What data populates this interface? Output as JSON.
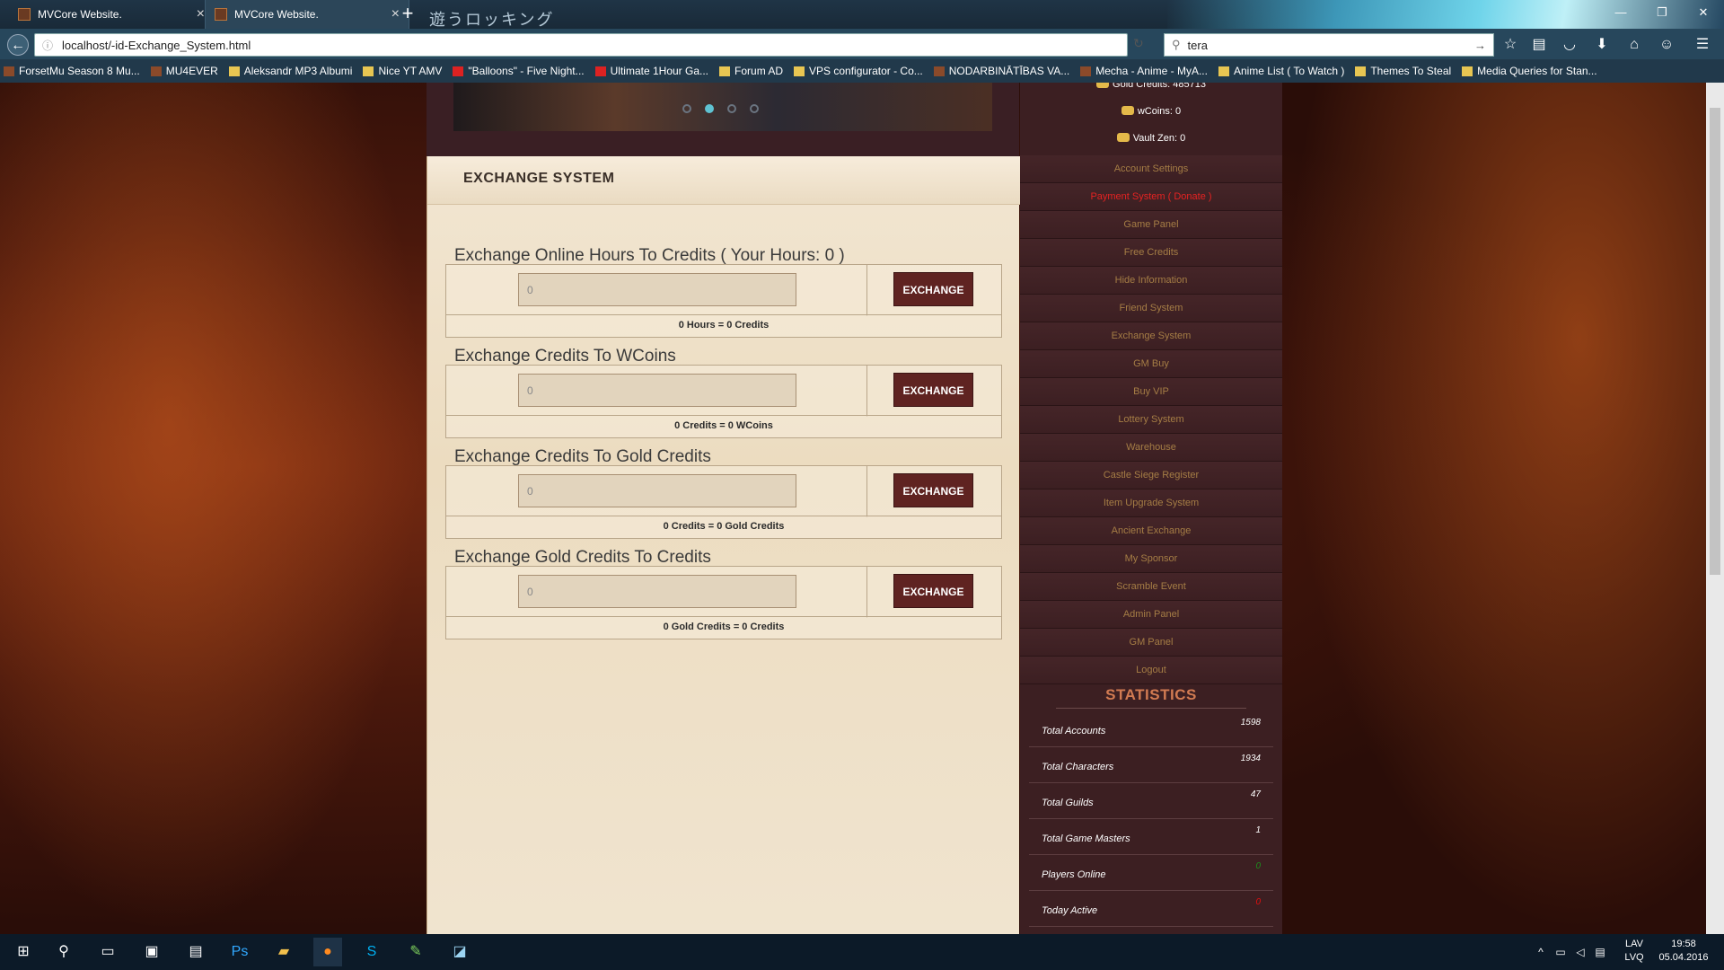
{
  "browser": {
    "tabs": [
      {
        "title": "MVCore Website.",
        "active": false
      },
      {
        "title": "MVCore Website.",
        "active": true
      }
    ],
    "banner_text": "遊うロッキング",
    "url": "localhost/-id-Exchange_System.html",
    "search_query": "tera",
    "bookmarks": [
      "ForsetMu Season 8 Mu...",
      "MU4EVER",
      "Aleksandr MP3 Albumi",
      "Nice YT AMV",
      "\"Balloons\" - Five Night...",
      "Ultimate 1Hour Ga...",
      "Forum AD",
      "VPS configurator - Co...",
      "NODARBINĀTĪBAS VA...",
      "Mecha - Anime - MyA...",
      "Anime List ( To Watch )",
      "Themes To Steal",
      "Media Queries for Stan..."
    ]
  },
  "page": {
    "title": "EXCHANGE SYSTEM",
    "exchange_button_label": "EXCHANGE",
    "exchanges": [
      {
        "heading": "Exchange Online Hours To Credits ( Your Hours: 0 )",
        "value": "0",
        "result": "0 Hours = 0 Credits"
      },
      {
        "heading": "Exchange Credits To WCoins",
        "value": "0",
        "result": "0 Credits = 0 WCoins"
      },
      {
        "heading": "Exchange Credits To Gold Credits",
        "value": "0",
        "result": "0 Credits = 0 Gold Credits"
      },
      {
        "heading": "Exchange Gold Credits To Credits",
        "value": "0",
        "result": "0 Gold Credits = 0 Credits"
      }
    ]
  },
  "sidebar": {
    "gold_credits": "Gold Credits: 485713",
    "wcoins": "wCoins: 0",
    "vault_zen": "Vault Zen: 0",
    "menu": [
      "Account Settings",
      "Payment System ( Donate )",
      "Game Panel",
      "Free Credits",
      "Hide Information",
      "Friend System",
      "Exchange System",
      "GM Buy",
      "Buy VIP",
      "Lottery System",
      "Warehouse",
      "Castle Siege Register",
      "Item Upgrade System",
      "Ancient Exchange",
      "My Sponsor",
      "Scramble Event",
      "Admin Panel",
      "GM Panel",
      "Logout"
    ],
    "highlight_color": "#e52222",
    "statistics_title": "STATISTICS",
    "statistics": [
      {
        "label": "Total Accounts",
        "value": "1598"
      },
      {
        "label": "Total Characters",
        "value": "1934"
      },
      {
        "label": "Total Guilds",
        "value": "47"
      },
      {
        "label": "Total Game Masters",
        "value": "1"
      },
      {
        "label": "Players Online",
        "value": "0"
      },
      {
        "label": "Today Active",
        "value": "0"
      }
    ]
  },
  "taskbar": {
    "language": "LAV",
    "layout": "LVQ",
    "time": "19:58",
    "date": "05.04.2016"
  }
}
